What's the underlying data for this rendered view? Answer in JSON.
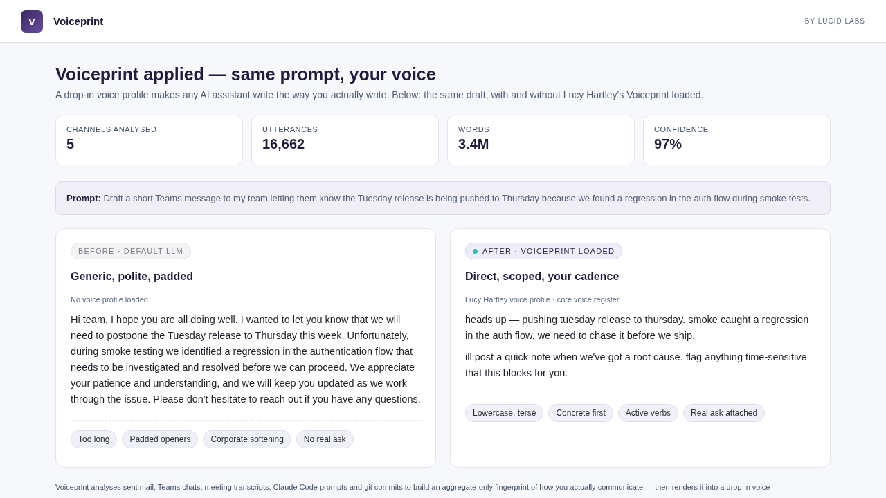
{
  "header": {
    "logo_letter": "v",
    "app_name": "Voiceprint",
    "byline": "BY LUCID LABS"
  },
  "title": "Voiceprint applied — same prompt, your voice",
  "subtitle": "A drop-in voice profile makes any AI assistant write the way you actually write. Below: the same draft, with and without Lucy Hartley's Voiceprint loaded.",
  "stats": [
    {
      "label": "CHANNELS ANALYSED",
      "value": "5"
    },
    {
      "label": "UTTERANCES",
      "value": "16,662"
    },
    {
      "label": "WORDS",
      "value": "3.4M"
    },
    {
      "label": "CONFIDENCE",
      "value": "97%"
    }
  ],
  "prompt": "**Prompt:** Draft a short Teams message to my team letting them know the Tuesday release is being pushed to Thursday because we found a regression in the auth flow during smoke tests.",
  "panels": [
    {
      "kind": "before",
      "badge": "BEFORE · DEFAULT LLM",
      "heading": "Generic, polite, padded",
      "caption": "No voice profile loaded",
      "paragraphs": [
        "Hi team, I hope you are all doing well. I wanted to let you know that we will need to postpone the Tuesday release to Thursday this week. Unfortunately, during smoke testing we identified a regression in the authentication flow that needs to be investigated and resolved before we can proceed. We appreciate your patience and understanding, and we will keep you updated as we work through the issue. Please don't hesitate to reach out if you have any questions."
      ],
      "tags": [
        "Too long",
        "Padded openers",
        "Corporate softening",
        "No real ask"
      ]
    },
    {
      "kind": "after",
      "badge": "AFTER · VOICEPRINT LOADED",
      "heading": "Direct, scoped, your cadence",
      "caption": "Lucy Hartley voice profile · core voice register",
      "paragraphs": [
        "heads up — pushing tuesday release to thursday. smoke caught a regression in the auth flow, we need to chase it before we ship.",
        "ill post a quick note when we've got a root cause. flag anything time-sensitive that this blocks for you."
      ],
      "tags": [
        "Lowercase, terse",
        "Concrete first",
        "Active verbs",
        "Real ask attached"
      ]
    }
  ],
  "footer": "Voiceprint analyses sent mail, Teams chats, meeting transcripts, Claude Code prompts and git commits to build an aggregate-only fingerprint of how you actually communicate — then renders it into a drop-in voice"
}
